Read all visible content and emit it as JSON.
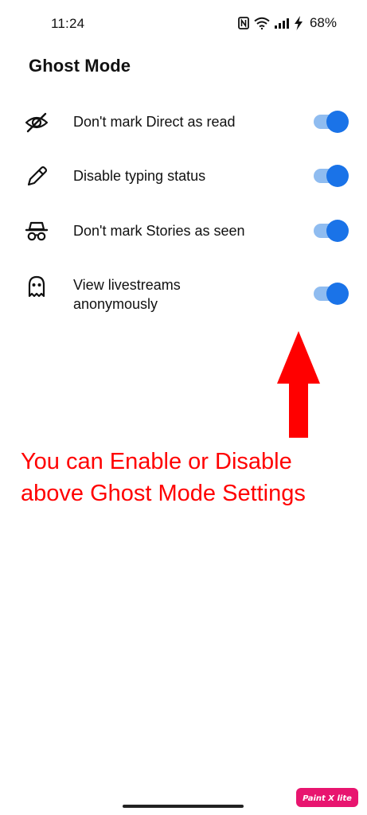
{
  "status_bar": {
    "time": "11:24",
    "battery": "68%",
    "icons": [
      "nfc-icon",
      "wifi-icon",
      "signal-icon",
      "charging-icon"
    ]
  },
  "page": {
    "title": "Ghost Mode"
  },
  "settings": [
    {
      "label": "Don't mark Direct as read",
      "icon": "eye-off-icon",
      "enabled": true
    },
    {
      "label": "Disable typing status",
      "icon": "pencil-icon",
      "enabled": true
    },
    {
      "label": "Don't mark Stories as seen",
      "icon": "incognito-icon",
      "enabled": true
    },
    {
      "label": "View livestreams anonymously",
      "icon": "ghost-icon",
      "enabled": true
    }
  ],
  "annotation": {
    "text": "You can Enable or Disable above Ghost Mode Settings",
    "color": "#ff0000"
  },
  "watermark": {
    "text": "Paint X lite"
  },
  "colors": {
    "toggle_on": "#1a73e8",
    "toggle_track_on": "#8fbcf0",
    "annotation": "#ff0000",
    "watermark_bg": "#e8156f"
  }
}
